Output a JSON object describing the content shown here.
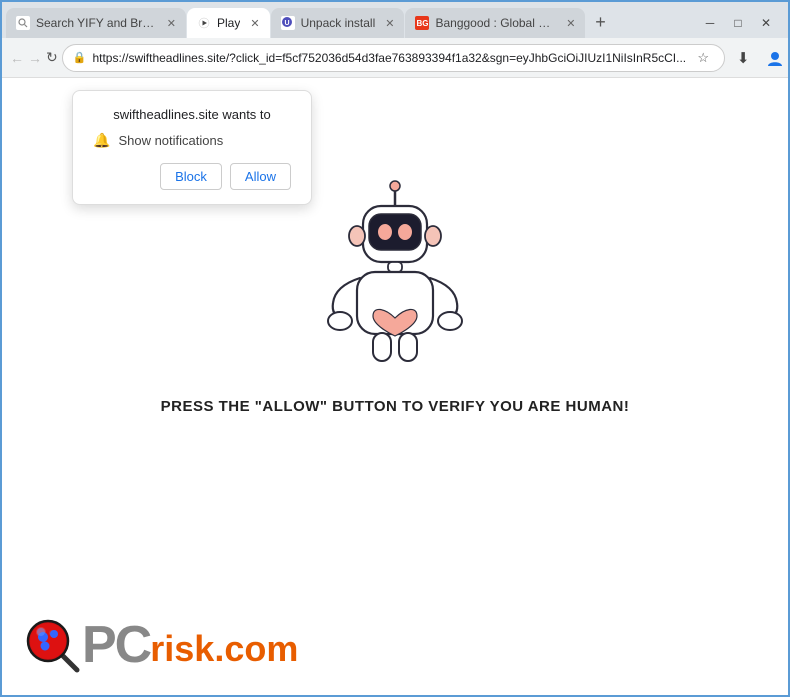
{
  "browser": {
    "tabs": [
      {
        "id": "tab-1",
        "label": "Search YIFY and Brow...",
        "favicon": "search",
        "active": false,
        "closeable": true
      },
      {
        "id": "tab-2",
        "label": "Play",
        "favicon": "play",
        "active": true,
        "closeable": true
      },
      {
        "id": "tab-3",
        "label": "Unpack install",
        "favicon": "unpack",
        "active": false,
        "closeable": true
      },
      {
        "id": "tab-4",
        "label": "Banggood : Global Le...",
        "favicon": "bg",
        "active": false,
        "closeable": true
      }
    ],
    "new_tab_label": "+",
    "window_controls": {
      "minimize": "─",
      "maximize": "□",
      "close": "✕"
    },
    "address_bar": {
      "url": "https://swiftheadlines.site/?click_id=f5cf752036d54d3fae763893394f1a32&sgn=eyJhbGciOiJIUzI1NiIsInR5cCI...",
      "lock_icon": "🔒"
    },
    "toolbar_icons": {
      "star": "☆",
      "download": "⬇",
      "profile": "👤",
      "menu": "⋮"
    }
  },
  "notification_popup": {
    "title": "swiftheadlines.site wants to",
    "bell_icon": "🔔",
    "notification_label": "Show notifications",
    "block_label": "Block",
    "allow_label": "Allow"
  },
  "page": {
    "robot_alt": "Robot illustration asking user to verify",
    "press_text": "PRESS THE \"ALLOW\" BUTTON TO VERIFY YOU ARE HUMAN!"
  },
  "logo": {
    "pc_text": "PC",
    "risk_text": "risk",
    "com_text": ".com"
  },
  "colors": {
    "accent_blue": "#1a73e8",
    "orange": "#e85d00",
    "gray": "#888888"
  }
}
